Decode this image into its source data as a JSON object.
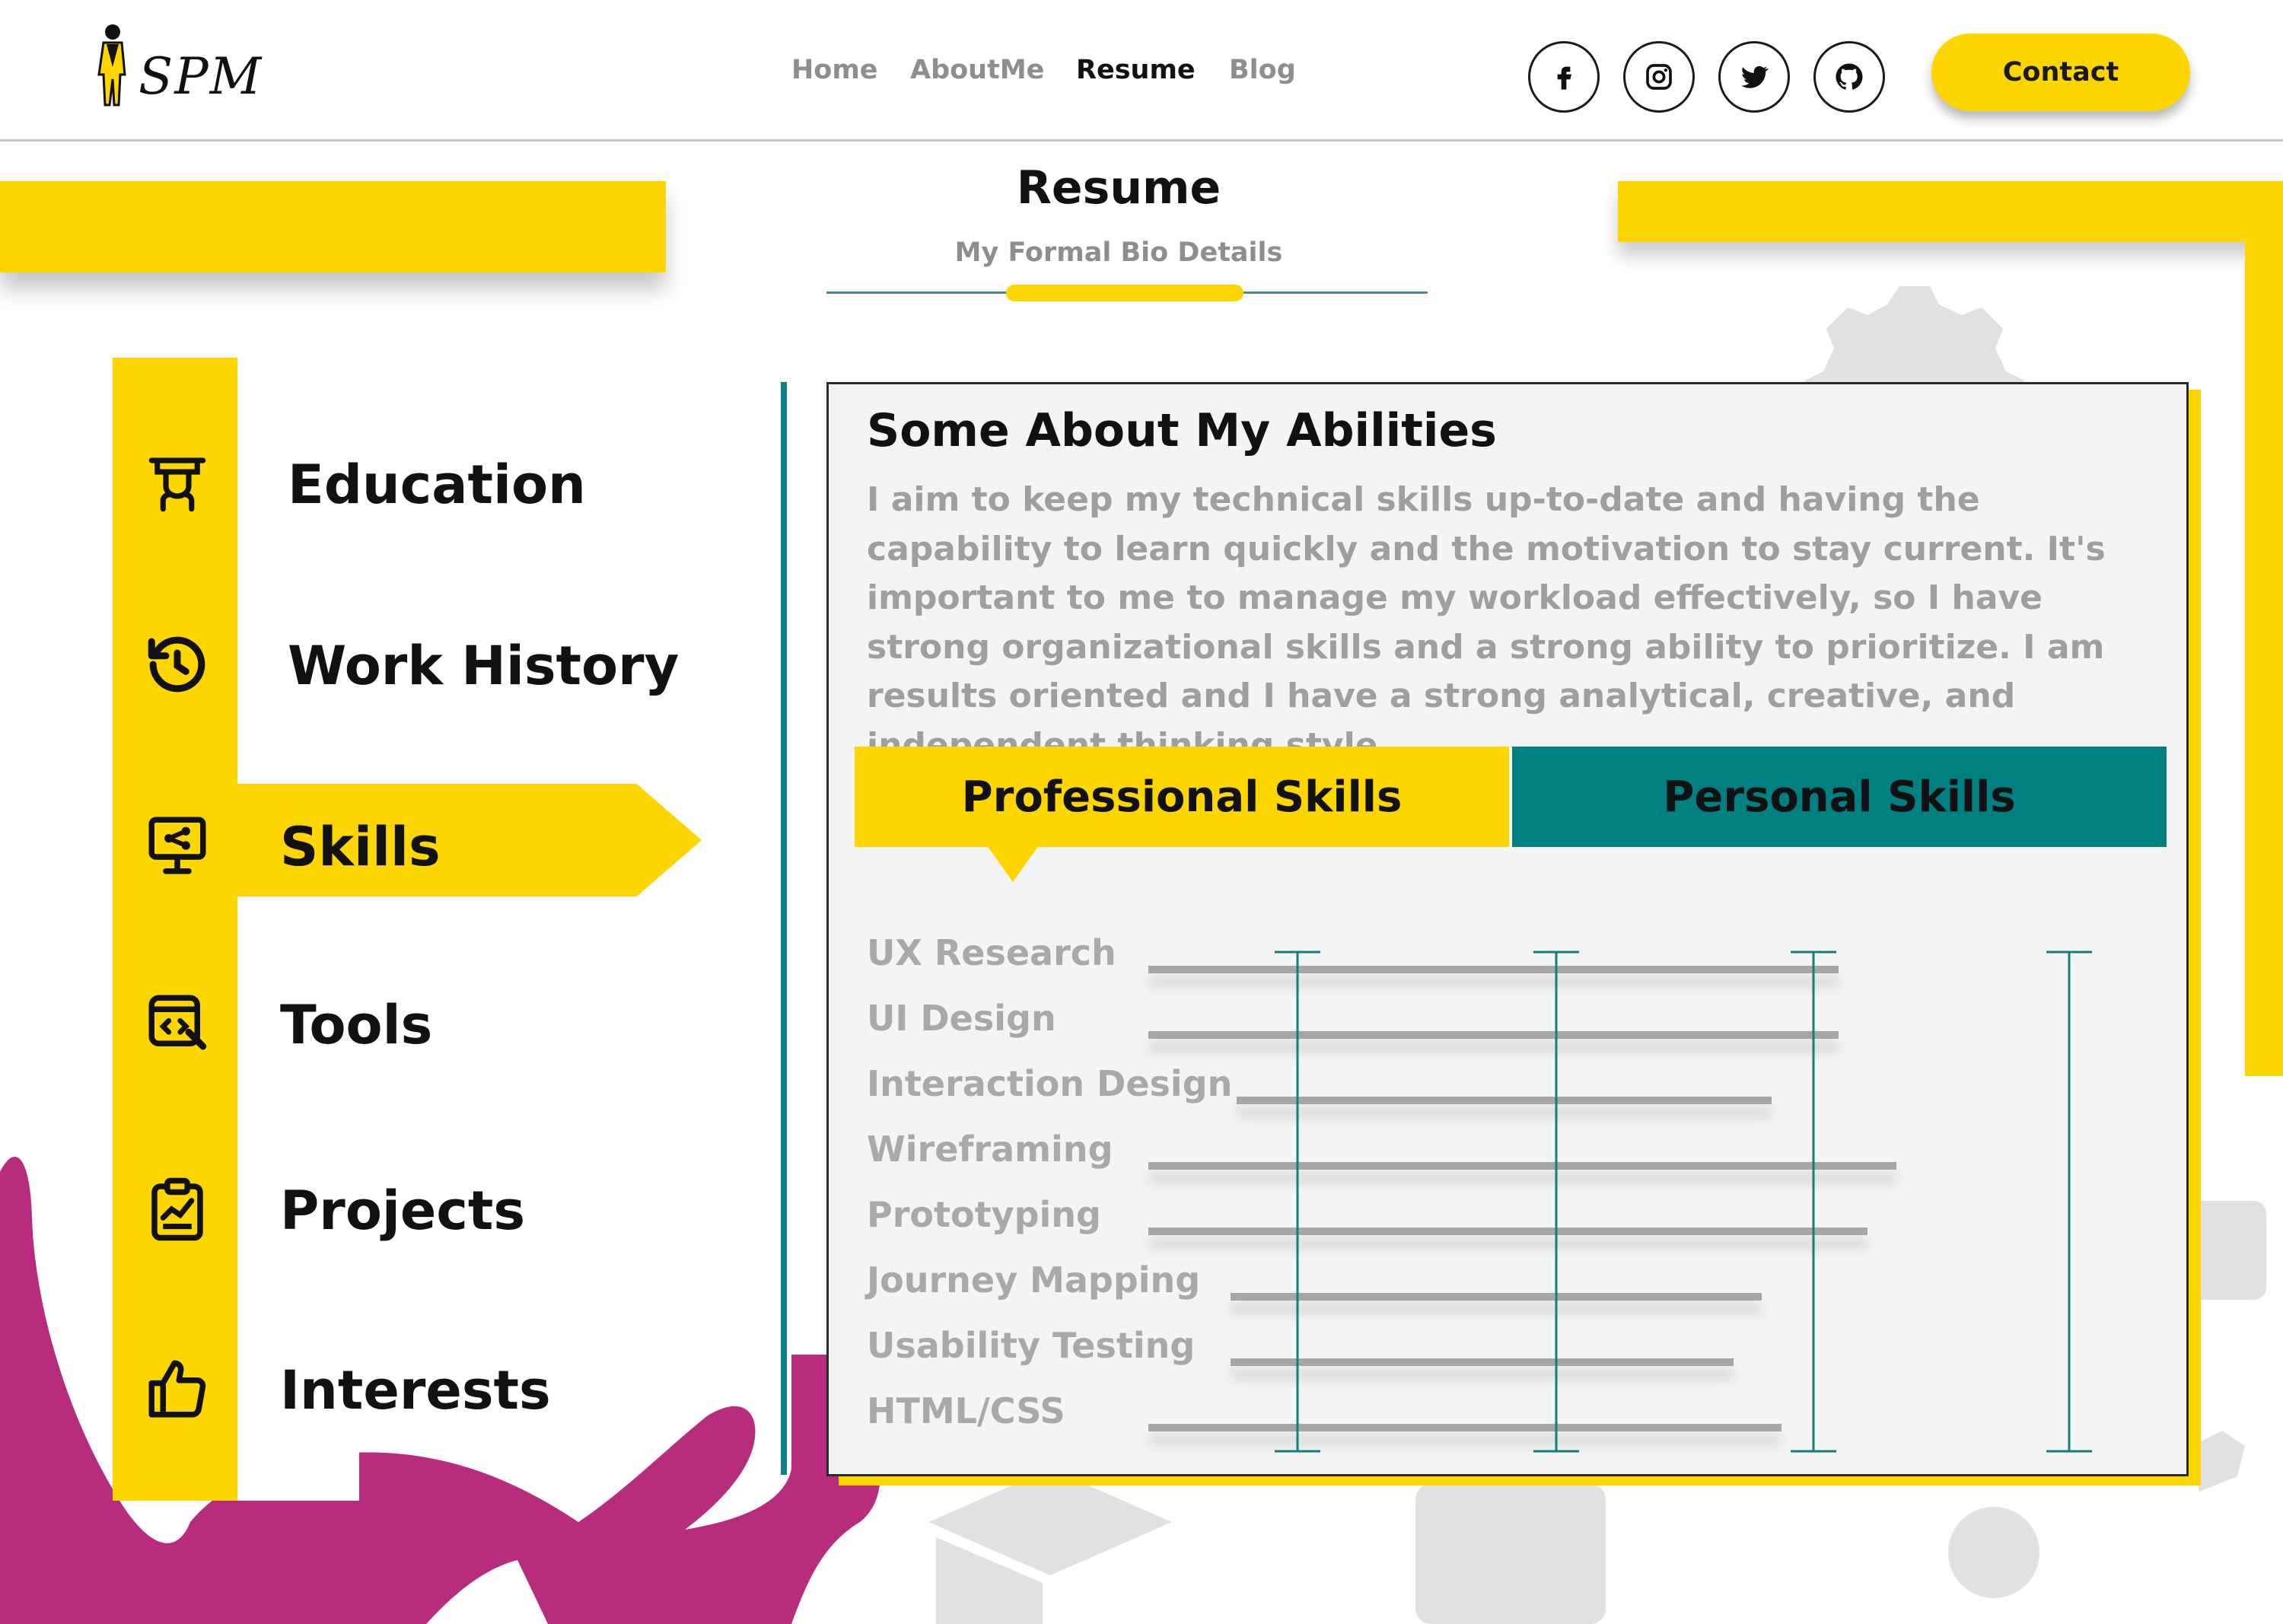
{
  "brand": {
    "logo_text": "SPM"
  },
  "nav": {
    "items": [
      {
        "label": "Home",
        "active": false
      },
      {
        "label": "AboutMe",
        "active": false
      },
      {
        "label": "Resume",
        "active": true
      },
      {
        "label": "Blog",
        "active": false
      }
    ]
  },
  "social": [
    {
      "icon": "facebook-icon"
    },
    {
      "icon": "instagram-icon"
    },
    {
      "icon": "twitter-icon"
    },
    {
      "icon": "github-icon"
    }
  ],
  "contact_label": "Contact",
  "page": {
    "title": "Resume",
    "subtitle": "My Formal Bio Details"
  },
  "sidebar": {
    "items": [
      {
        "label": "Education",
        "icon": "education-icon",
        "active": false
      },
      {
        "label": "Work History",
        "icon": "history-icon",
        "active": false
      },
      {
        "label": "Skills",
        "icon": "presentation-icon",
        "active": true
      },
      {
        "label": "Tools",
        "icon": "code-tools-icon",
        "active": false
      },
      {
        "label": "Projects",
        "icon": "clipboard-chart-icon",
        "active": false
      },
      {
        "label": "Interests",
        "icon": "thumbs-up-icon",
        "active": false
      }
    ]
  },
  "abilities": {
    "title": "Some About My Abilities",
    "text": "I aim to keep my technical skills up-to-date and  having the capability  to learn quickly and the motivation to stay current. It's important to me to manage my workload effectively, so I have strong organizational skills and a strong ability to prioritize.  I am results oriented and I have a strong analytical, creative, and independent thinking style."
  },
  "tabs": {
    "professional": "Professional Skills",
    "personal": "Personal Skills",
    "active": "professional"
  },
  "skills": [
    {
      "name": "UX Research",
      "level": 0.72
    },
    {
      "name": "UI Design",
      "level": 0.72
    },
    {
      "name": "Interaction Design",
      "level": 0.65
    },
    {
      "name": "Wireframing",
      "level": 0.78
    },
    {
      "name": "Prototyping",
      "level": 0.75
    },
    {
      "name": "Journey Mapping",
      "level": 0.64
    },
    {
      "name": "Usability Testing",
      "level": 0.61
    },
    {
      "name": "HTML/CSS",
      "level": 0.66
    }
  ],
  "colors": {
    "accent": "#FDD600",
    "teal": "#008080",
    "magenta": "#B82C7E",
    "text_dark": "#111111",
    "text_gray": "#9f9f9f"
  }
}
